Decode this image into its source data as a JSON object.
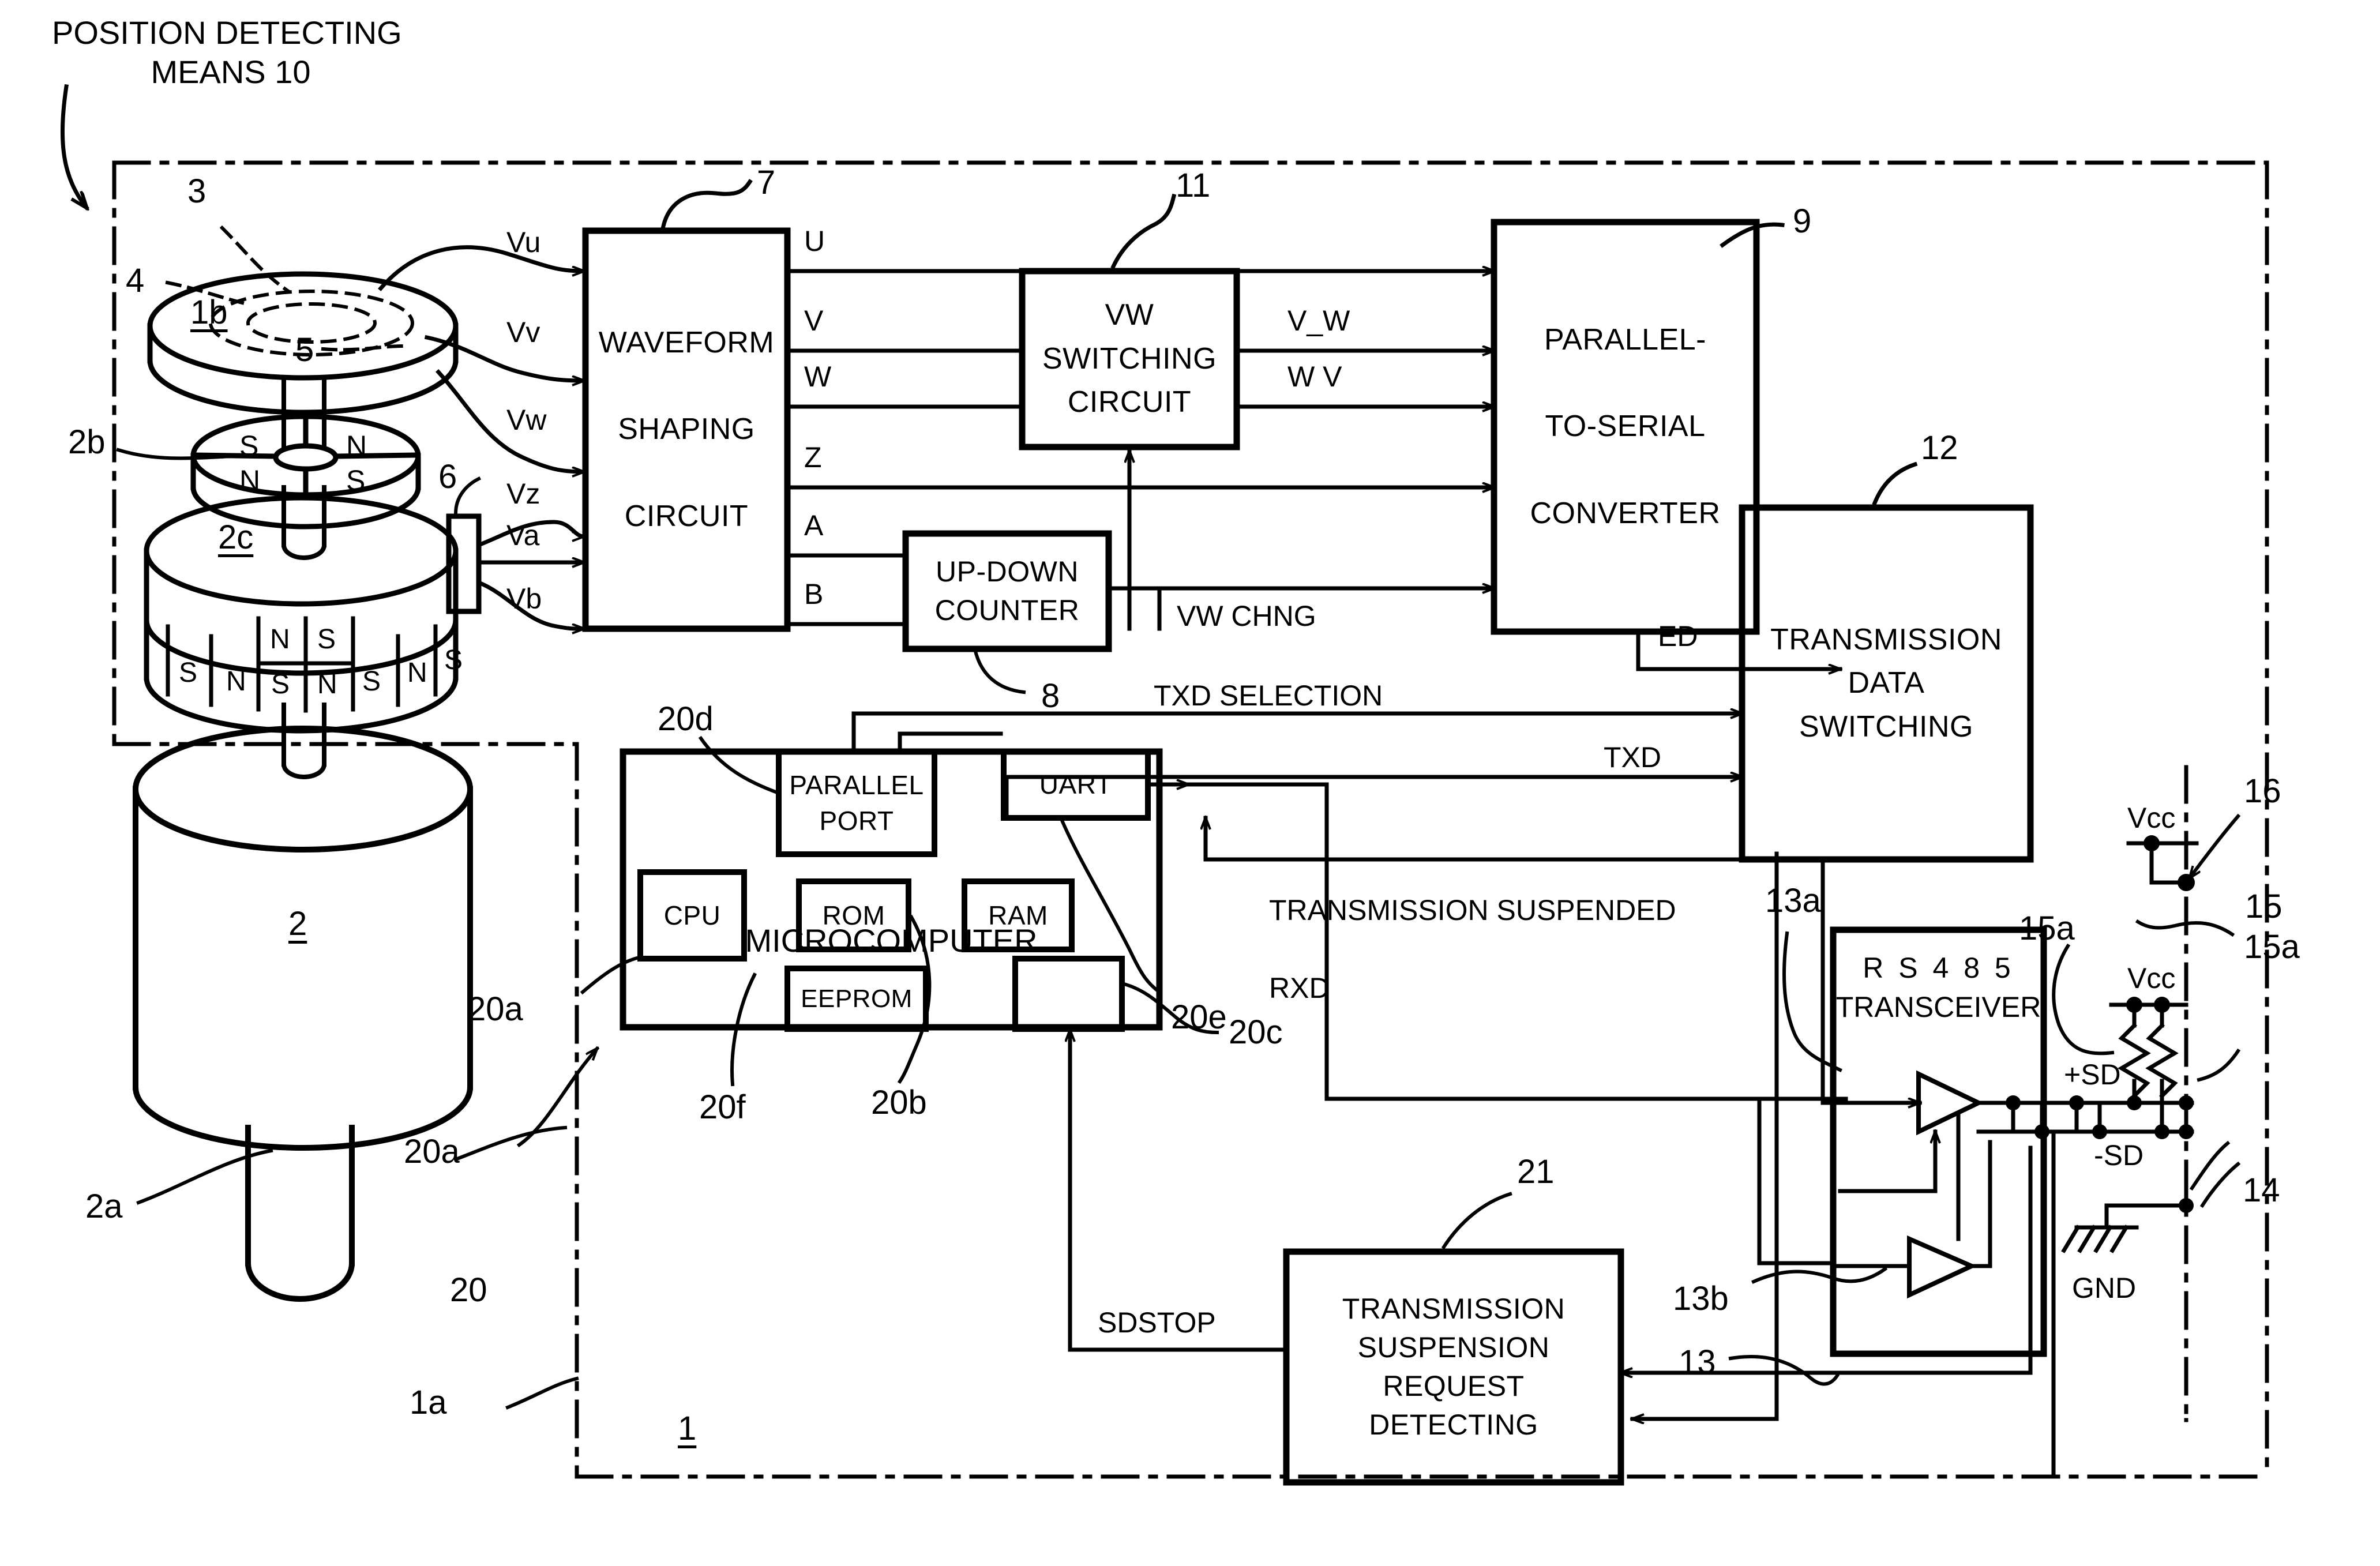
{
  "figure": {
    "title": "POSITION DETECTING\nMEANS 10",
    "title_line1": "POSITION DETECTING",
    "title_line2": "MEANS 10"
  },
  "blocks": [
    {
      "id": "waveform",
      "label": "WAVEFORM\n\nSHAPING\n\nCIRCUIT",
      "ref": "7"
    },
    {
      "id": "vw_switching",
      "label": "VW\nSWITCHING\nCIRCUIT",
      "ref": "11"
    },
    {
      "id": "parallel_to_serial",
      "label": "PARALLEL-\n\nTO-SERIAL\n\nCONVERTER",
      "ref": "9"
    },
    {
      "id": "up_down_counter",
      "label": "UP-DOWN\nCOUNTER",
      "ref": "8"
    },
    {
      "id": "transmission_data_switching",
      "label": "TRANSMISSION\nDATA\nSWITCHING",
      "ref": "12"
    },
    {
      "id": "microcomputer",
      "label": "MICROCOMPUTER",
      "ref": "20"
    },
    {
      "id": "parallel_port",
      "label": "PARALLEL\nPORT",
      "ref": "20d"
    },
    {
      "id": "uart",
      "label": "UART",
      "ref": "20e"
    },
    {
      "id": "cpu",
      "label": "CPU",
      "ref": "20a"
    },
    {
      "id": "rom",
      "label": "ROM",
      "ref": "20b"
    },
    {
      "id": "ram",
      "label": "RAM",
      "ref": ""
    },
    {
      "id": "eeprom",
      "label": "EEPROM",
      "ref": "20f"
    },
    {
      "id": "unnamed_port",
      "label": "",
      "ref": "20c"
    },
    {
      "id": "rs485",
      "label": "R S 4 8 5\nTRANSCEIVER",
      "ref": "13"
    },
    {
      "id": "tx_suspension",
      "label": "TRANSMISSION\nSUSPENSION\nREQUEST\nDETECTING",
      "ref": "21"
    }
  ],
  "block_labels": {
    "waveform": "WAVEFORM\n\nSHAPING\n\nCIRCUIT",
    "vw_switching": "VW\nSWITCHING\nCIRCUIT",
    "parallel_to_serial": "PARALLEL-\n\nTO-SERIAL\n\nCONVERTER",
    "up_down_counter": "UP-DOWN\nCOUNTER",
    "transmission_data_switching": "TRANSMISSION\nDATA\nSWITCHING",
    "microcomputer": "MICROCOMPUTER",
    "parallel_port": "PARALLEL\nPORT",
    "uart": "UART",
    "cpu": "CPU",
    "rom": "ROM",
    "ram": "RAM",
    "eeprom": "EEPROM",
    "rs485": "R S 4 8 5\nTRANSCEIVER",
    "rs485_line1": "R S 4 8 5",
    "rs485_line2": "TRANSCEIVER",
    "tx_suspension": "TRANSMISSION\nSUSPENSION\nREQUEST\nDETECTING"
  },
  "signals": {
    "vu": "Vu",
    "vv": "Vv",
    "vw": "Vw",
    "vz": "Vz",
    "va": "Va",
    "vb": "Vb",
    "u": "U",
    "v": "V",
    "w": "W",
    "z": "Z",
    "a": "A",
    "b": "B",
    "v_w": "V_W",
    "w_v": "W V",
    "vw_chng": "VW CHNG",
    "ed": "ED",
    "txd_selection": "TXD SELECTION",
    "txd": "TXD",
    "transmission_suspended": "TRANSMISSION SUSPENDED",
    "rxd": "RXD",
    "sdstop": "SDSTOP",
    "plus_sd": "+SD",
    "minus_sd": "-SD",
    "gnd": "GND",
    "vcc_top": "Vcc",
    "vcc_bottom": "Vcc"
  },
  "reference_numerals": {
    "n1": "1",
    "n1a": "1a",
    "n1b": "1b",
    "n2": "2",
    "n2a": "2a",
    "n2b": "2b",
    "n2c": "2c",
    "n3": "3",
    "n4": "4",
    "n5": "5",
    "n6": "6",
    "n7": "7",
    "n8": "8",
    "n9": "9",
    "n11": "11",
    "n12": "12",
    "n13": "13",
    "n13a": "13a",
    "n13b": "13b",
    "n14": "14",
    "n15": "15",
    "n15a_right": "15a",
    "n15a_left": "15a",
    "n16": "16",
    "n20": "20",
    "n20a": "20a",
    "n20b": "20b",
    "n20c": "20c",
    "n20d": "20d",
    "n20e": "20e",
    "n20f": "20f",
    "n21": "21"
  },
  "magnet_poles": {
    "disc_top": [
      "S",
      "N",
      "N",
      "S"
    ],
    "drum_row_upper": [
      "N",
      "S"
    ],
    "drum_row_lower": [
      "S",
      "N",
      "S",
      "N",
      "S",
      "N",
      "S"
    ]
  }
}
